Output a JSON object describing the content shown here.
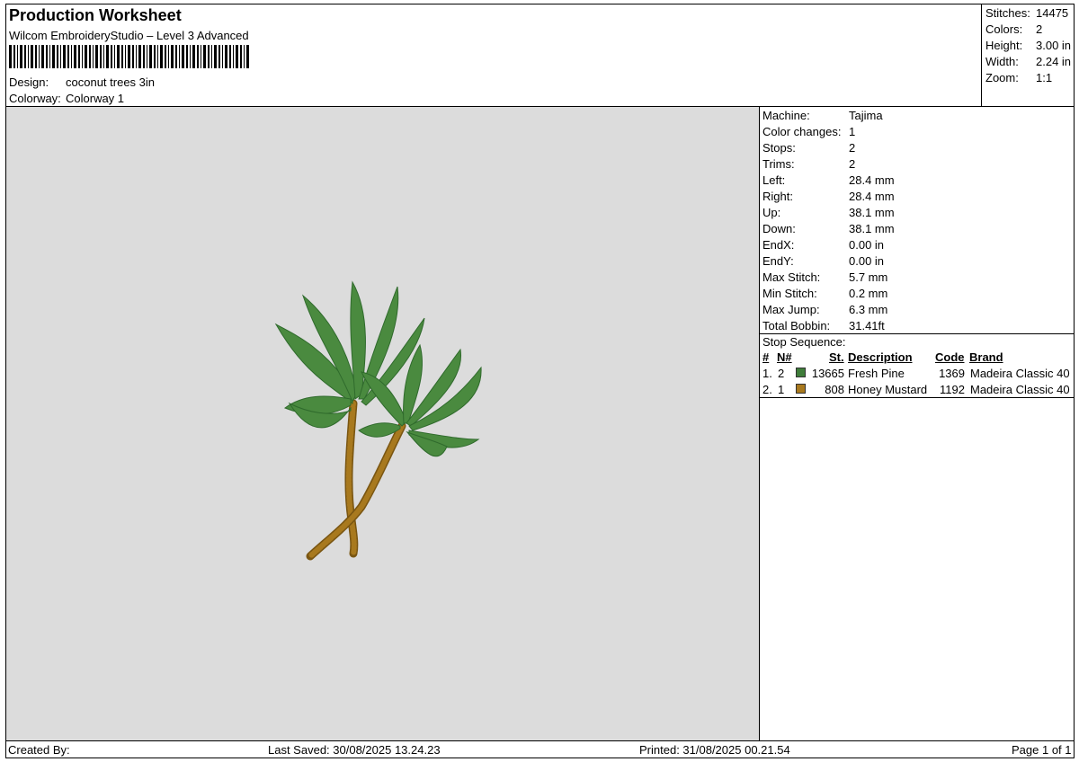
{
  "header": {
    "title": "Production Worksheet",
    "software": "Wilcom EmbroideryStudio – Level 3 Advanced",
    "design_label": "Design:",
    "design_value": "coconut trees 3in",
    "colorway_label": "Colorway:",
    "colorway_value": "Colorway 1"
  },
  "summary": {
    "stitches_label": "Stitches:",
    "stitches_value": "14475",
    "colors_label": "Colors:",
    "colors_value": "2",
    "height_label": "Height:",
    "height_value": "3.00 in",
    "width_label": "Width:",
    "width_value": "2.24 in",
    "zoom_label": "Zoom:",
    "zoom_value": "1:1"
  },
  "specs": [
    {
      "label": "Machine:",
      "value": "Tajima"
    },
    {
      "label": "Color changes:",
      "value": "1"
    },
    {
      "label": "Stops:",
      "value": "2"
    },
    {
      "label": "Trims:",
      "value": "2"
    },
    {
      "label": "Left:",
      "value": "28.4 mm"
    },
    {
      "label": "Right:",
      "value": "28.4 mm"
    },
    {
      "label": "Up:",
      "value": "38.1 mm"
    },
    {
      "label": "Down:",
      "value": "38.1 mm"
    },
    {
      "label": "EndX:",
      "value": "0.00 in"
    },
    {
      "label": "EndY:",
      "value": "0.00 in"
    },
    {
      "label": "Max Stitch:",
      "value": "5.7 mm"
    },
    {
      "label": "Min Stitch:",
      "value": "0.2 mm"
    },
    {
      "label": "Max Jump:",
      "value": "6.3 mm"
    },
    {
      "label": "Total Bobbin:",
      "value": "31.41ft"
    }
  ],
  "stop_sequence": {
    "title": "Stop Sequence:",
    "headers": {
      "index": "#",
      "needle": "N#",
      "stitches": "St.",
      "description": "Description",
      "code": "Code",
      "brand": "Brand"
    },
    "rows": [
      {
        "index": "1.",
        "needle": "2",
        "color": "#3f7d3a",
        "stitches": "13665",
        "description": "Fresh Pine",
        "code": "1369",
        "brand": "Madeira Classic 40"
      },
      {
        "index": "2.",
        "needle": "1",
        "color": "#a8791e",
        "stitches": "808",
        "description": "Honey Mustard",
        "code": "1192",
        "brand": "Madeira Classic 40"
      }
    ]
  },
  "footer": {
    "created_by": "Created By:",
    "last_saved": "Last Saved: 30/08/2025 13.24.23",
    "printed": "Printed: 31/08/2025 00.21.54",
    "page": "Page 1 of 1"
  },
  "colors": {
    "canvas": "#dcdcdc",
    "leaf": "#4a8a3f",
    "leaf_dark": "#2f6a2c",
    "trunk": "#a8791e",
    "trunk_dark": "#7a5612"
  }
}
